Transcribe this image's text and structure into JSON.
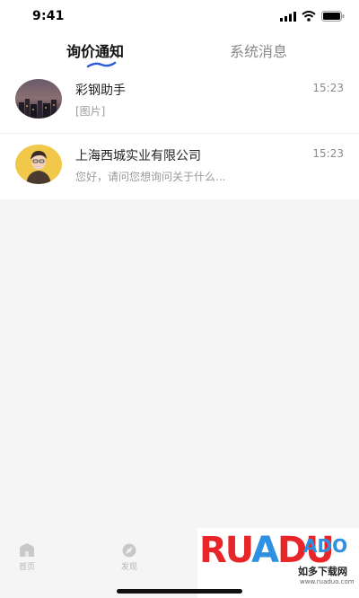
{
  "status_bar": {
    "time": "9:41"
  },
  "tabs": [
    {
      "label": "询价通知",
      "active": true
    },
    {
      "label": "系统消息",
      "active": false
    }
  ],
  "messages": [
    {
      "name": "彩钢助手",
      "preview": "[图片]",
      "time": "15:23",
      "avatar": "night-city-photo"
    },
    {
      "name": "上海西城实业有限公司",
      "preview": "您好，请问您想询问关于什么...",
      "time": "15:23",
      "avatar": "person-photo"
    }
  ],
  "tabbar": [
    {
      "label": "首页",
      "icon": "home-icon"
    },
    {
      "label": "发现",
      "icon": "discover-icon"
    }
  ],
  "watermark": {
    "logo": "RUANDUO",
    "ado": "ADO",
    "name": "如多下载网",
    "url": "www.ruaduo.com"
  },
  "colors": {
    "accent": "#2f5bd8",
    "background": "#f5f5f5"
  }
}
